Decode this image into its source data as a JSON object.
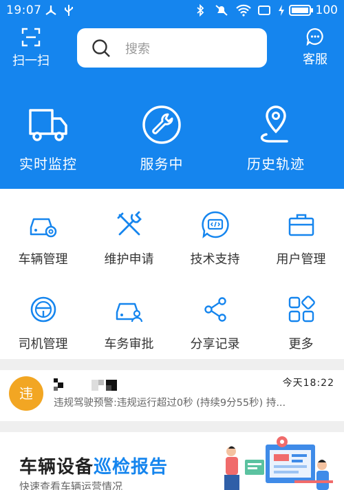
{
  "status_bar": {
    "time": "19:07",
    "battery": "100"
  },
  "header": {
    "scan_label": "扫一扫",
    "service_label": "客服",
    "search": {
      "placeholder": "搜索"
    }
  },
  "features": [
    {
      "label": "实时监控",
      "icon": "truck-icon"
    },
    {
      "label": "服务中",
      "icon": "wrench-icon"
    },
    {
      "label": "历史轨迹",
      "icon": "location-pin-icon"
    }
  ],
  "grid": [
    {
      "label": "车辆管理",
      "icon": "car-gear-icon"
    },
    {
      "label": "维护申请",
      "icon": "tools-icon"
    },
    {
      "label": "技术支持",
      "icon": "code-bubble-icon"
    },
    {
      "label": "用户管理",
      "icon": "briefcase-icon"
    },
    {
      "label": "司机管理",
      "icon": "steering-wheel-icon"
    },
    {
      "label": "车务审批",
      "icon": "car-person-icon"
    },
    {
      "label": "分享记录",
      "icon": "share-icon"
    },
    {
      "label": "更多",
      "icon": "grid-more-icon"
    }
  ],
  "notice": {
    "badge": "违",
    "time": "今天18:22",
    "message": "违规驾驶预警:违规运行超过0秒 (持续9分55秒) 持..."
  },
  "banner": {
    "title_part1": "车辆设备",
    "title_part2": "巡检报告",
    "subtitle": "快速查看车辆运营情况"
  },
  "colors": {
    "primary": "#1585ee",
    "badge": "#f2a623"
  }
}
